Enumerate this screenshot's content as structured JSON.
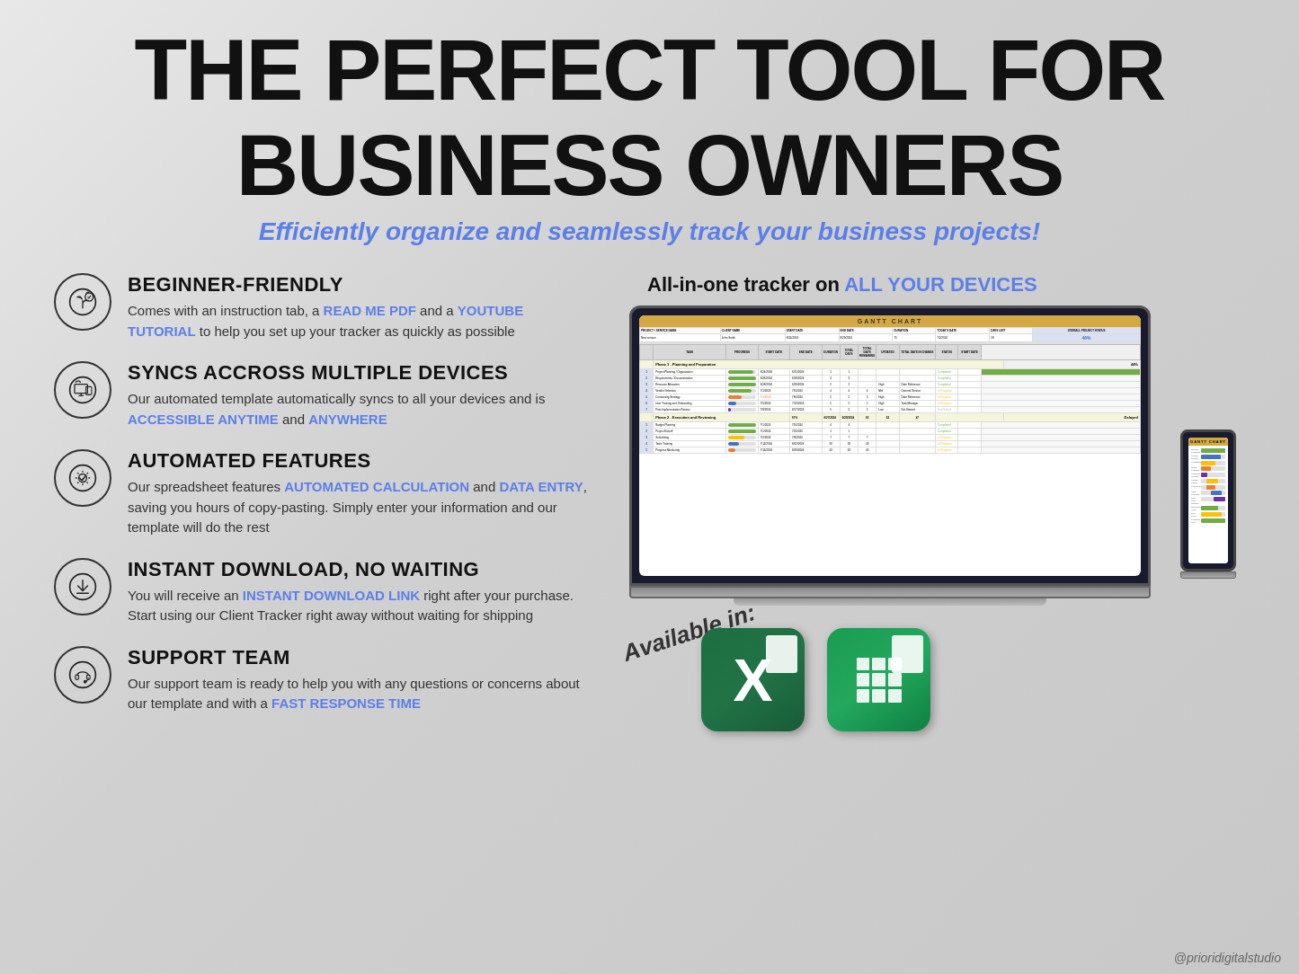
{
  "page": {
    "title_line1": "THE PERFECT TOOL FOR",
    "title_line2": "BUSINESS OWNERS",
    "subtitle": "Efficiently organize and seamlessly track your business projects!",
    "background_color": "#d0d0d0"
  },
  "features": [
    {
      "id": "beginner",
      "icon": "seedling-icon",
      "title": "BEGINNER-FRIENDLY",
      "description_prefix": "Comes with an instruction tab, a ",
      "link1": "READ ME PDF",
      "description_middle": " and a ",
      "link2": "YOUTUBE TUTORIAL",
      "description_suffix": " to help you set up your tracker as quickly as possible"
    },
    {
      "id": "syncs",
      "icon": "multi-device-icon",
      "title": "SYNCS ACCROSS MULTIPLE DEVICES",
      "description_prefix": "Our automated template automatically syncs to all your devices and is ",
      "link1": "ACCESSIBLE ANYTIME",
      "description_middle": " and ",
      "link2": "ANYWHERE",
      "description_suffix": ""
    },
    {
      "id": "automated",
      "icon": "checkmark-gear-icon",
      "title": "AUTOMATED FEATURES",
      "description_prefix": "Our spreadsheet features ",
      "link1": "AUTOMATED CALCULATION",
      "description_middle": " and ",
      "link2": "DATA ENTRY",
      "description_suffix": ", saving you hours of copy-pasting. Simply enter your information and our template will do the rest"
    },
    {
      "id": "download",
      "icon": "download-icon",
      "title": "INSTANT DOWNLOAD, NO WAITING",
      "description_prefix": "You will receive an ",
      "link1": "INSTANT DOWNLOAD LINK",
      "description_middle": " right after your purchase. Start using our Client Tracker right away without waiting for shipping",
      "link2": "",
      "description_suffix": ""
    },
    {
      "id": "support",
      "icon": "headset-icon",
      "title": "SUPPORT TEAM",
      "description_prefix": "Our support team is ready to help you with any questions or concerns about our template and with a ",
      "link1": "FAST RESPONSE TIME",
      "description_middle": "",
      "link2": "",
      "description_suffix": ""
    }
  ],
  "right_section": {
    "title_prefix": "All-in-one tracker on ",
    "title_highlight": "ALL YOUR DEVICES",
    "available_label": "Available in:",
    "apps": [
      {
        "name": "Microsoft Excel",
        "short": "X",
        "type": "excel"
      },
      {
        "name": "Google Sheets",
        "short": "sheets",
        "type": "sheets"
      }
    ]
  },
  "watermark": "@prioridigitalstudio"
}
